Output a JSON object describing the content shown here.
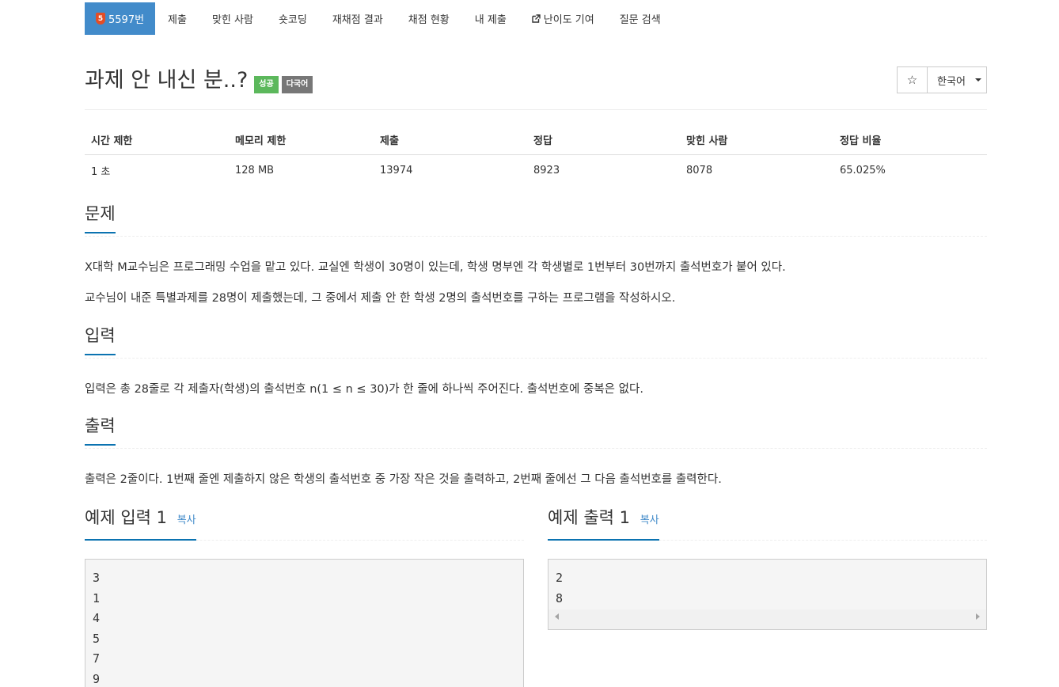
{
  "nav": {
    "problem_id": "5597번",
    "items": [
      "제출",
      "맞힌 사람",
      "숏코딩",
      "재채점 결과",
      "채점 현황",
      "내 제출",
      "난이도 기여",
      "질문 검색"
    ]
  },
  "header": {
    "title": "과제 안 내신 분..?",
    "badge_success": "성공",
    "badge_multilang": "다국어",
    "star": "☆",
    "language": "한국어"
  },
  "info": {
    "headers": [
      "시간 제한",
      "메모리 제한",
      "제출",
      "정답",
      "맞힌 사람",
      "정답 비율"
    ],
    "values": [
      "1 초",
      "128 MB",
      "13974",
      "8923",
      "8078",
      "65.025%"
    ]
  },
  "sections": {
    "problem": {
      "title": "문제",
      "lines": [
        "X대학 M교수님은 프로그래밍 수업을 맡고 있다. 교실엔 학생이 30명이 있는데, 학생 명부엔 각 학생별로 1번부터 30번까지 출석번호가 붙어 있다.",
        "교수님이 내준 특별과제를 28명이 제출했는데, 그 중에서 제출 안 한 학생 2명의 출석번호를 구하는 프로그램을 작성하시오."
      ]
    },
    "input": {
      "title": "입력",
      "text": "입력은 총 28줄로 각 제출자(학생)의 출석번호 n(1 ≤ n ≤ 30)가 한 줄에 하나씩 주어진다. 출석번호에 중복은 없다."
    },
    "output": {
      "title": "출력",
      "text": "출력은 2줄이다. 1번째 줄엔 제출하지 않은 학생의 출석번호 중 가장 작은 것을 출력하고, 2번째 줄에선 그 다음 출석번호를 출력한다."
    }
  },
  "samples": {
    "input": {
      "title": "예제 입력 1",
      "copy": "복사",
      "lines": [
        "3",
        "1",
        "4",
        "5",
        "7",
        "9"
      ]
    },
    "output": {
      "title": "예제 출력 1",
      "copy": "복사",
      "lines": [
        "2",
        "8"
      ]
    }
  }
}
